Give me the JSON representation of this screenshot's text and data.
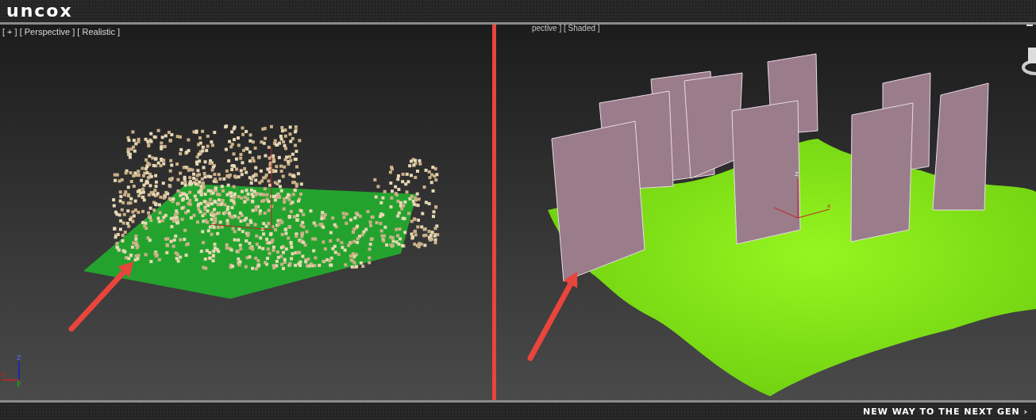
{
  "header": {
    "logo": "uncox"
  },
  "left_viewport": {
    "labels": [
      "[ + ]",
      "[ Perspective ]",
      "[ Realistic ]"
    ],
    "gizmo": {
      "x": "x",
      "y": "y",
      "z": "z"
    }
  },
  "right_viewport": {
    "labels": [
      "pective ] [ Shaded ]"
    ],
    "gizmo": {
      "x": "x",
      "z": "z"
    }
  },
  "footer": {
    "tagline": "NEW WAY TO THE NEXT GEN ›"
  }
}
